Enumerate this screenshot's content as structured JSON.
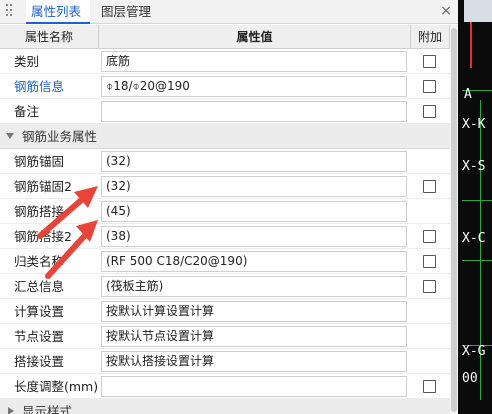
{
  "tabs": {
    "properties": "属性列表",
    "layers": "图层管理",
    "close_glyph": "×"
  },
  "header": {
    "name": "属性名称",
    "value": "属性值",
    "extra": "附加"
  },
  "rows_top": [
    {
      "label": "类别",
      "value": "底筋",
      "checkbox": true,
      "highlight": false
    },
    {
      "label": "钢筋信息",
      "value": "⌽18/⌽20@190",
      "checkbox": true,
      "highlight": true
    },
    {
      "label": "备注",
      "value": "",
      "checkbox": true,
      "highlight": false
    }
  ],
  "group1": {
    "label": "钢筋业务属性",
    "expanded": true
  },
  "rows_group": [
    {
      "label": "钢筋锚固",
      "value": "(32)",
      "checkbox": false
    },
    {
      "label": "钢筋锚固2",
      "value": "(32)",
      "checkbox": true
    },
    {
      "label": "钢筋搭接",
      "value": "(45)",
      "checkbox": false
    },
    {
      "label": "钢筋搭接2",
      "value": "(38)",
      "checkbox": true
    },
    {
      "label": "归类名称",
      "value": "(RF 500 C18/C20@190)",
      "checkbox": true
    },
    {
      "label": "汇总信息",
      "value": "(筏板主筋)",
      "checkbox": true
    },
    {
      "label": "计算设置",
      "value": "按默认计算设置计算",
      "checkbox": false
    },
    {
      "label": "节点设置",
      "value": "按默认节点设置计算",
      "checkbox": false
    },
    {
      "label": "搭接设置",
      "value": "按默认搭接设置计算",
      "checkbox": false
    },
    {
      "label": "长度调整(mm)",
      "value": "",
      "checkbox": true
    }
  ],
  "group2": {
    "label": "显示样式",
    "expanded": false
  },
  "drawing": {
    "labels": [
      "A",
      "X-K",
      "X-S",
      "X-C",
      "X-G",
      "00"
    ]
  },
  "colors": {
    "accent": "#1a62d6",
    "arrow": "#e8443a",
    "drawing_bg": "#0b0b0b",
    "drawing_line": "#2aa845"
  }
}
